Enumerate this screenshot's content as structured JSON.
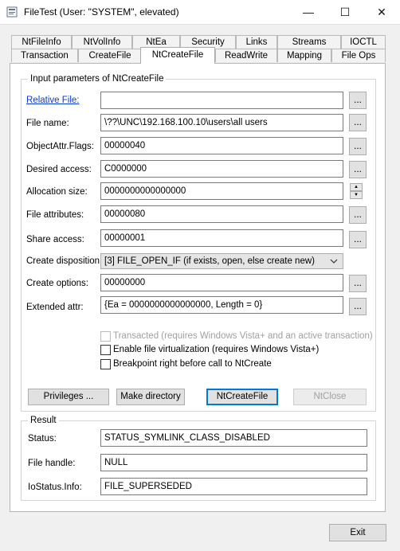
{
  "window": {
    "title": "FileTest (User: \"SYSTEM\", elevated)",
    "minimize": "—",
    "maximize": "☐",
    "close": "✕"
  },
  "tabs": {
    "row1": [
      "NtFileInfo",
      "NtVolInfo",
      "NtEa",
      "Security",
      "Links",
      "Streams",
      "IOCTL"
    ],
    "row2": [
      "Transaction",
      "CreateFile",
      "NtCreateFile",
      "ReadWrite",
      "Mapping",
      "File Ops"
    ],
    "active": "NtCreateFile"
  },
  "input_group": {
    "title": "Input parameters of NtCreateFile",
    "relative_file_label": "Relative File:",
    "relative_file_value": "",
    "file_name_label": "File name:",
    "file_name_value": "\\??\\UNC\\192.168.100.10\\users\\all users",
    "objattr_label": "ObjectAttr.Flags:",
    "objattr_value": "00000040",
    "desired_access_label": "Desired access:",
    "desired_access_value": "C0000000",
    "allocation_label": "Allocation size:",
    "allocation_value": "0000000000000000",
    "file_attr_label": "File attributes:",
    "file_attr_value": "00000080",
    "share_label": "Share access:",
    "share_value": "00000001",
    "disposition_label": "Create disposition:",
    "disposition_value": "[3] FILE_OPEN_IF (if exists, open, else create new)",
    "options_label": "Create options:",
    "options_value": "00000000",
    "ea_label": "Extended attr:",
    "ea_value": "{Ea = 0000000000000000, Length = 0}",
    "browse": "...",
    "checkboxes": [
      {
        "label": "Transacted (requires Windows Vista+ and an active transaction)",
        "checked": false,
        "enabled": false
      },
      {
        "label": "Enable file virtualization (requires Windows Vista+)",
        "checked": false,
        "enabled": true
      },
      {
        "label": "Breakpoint right before call to NtCreate",
        "checked": false,
        "enabled": true
      }
    ],
    "buttons": {
      "privileges": "Privileges ...",
      "make_directory": "Make directory",
      "ntcreatefile": "NtCreateFile",
      "ntclose": "NtClose"
    }
  },
  "result_group": {
    "title": "Result",
    "status_label": "Status:",
    "status_value": "STATUS_SYMLINK_CLASS_DISABLED",
    "handle_label": "File handle:",
    "handle_value": "NULL",
    "iostatus_label": "IoStatus.Info:",
    "iostatus_value": "FILE_SUPERSEDED"
  },
  "footer": {
    "exit": "Exit"
  },
  "colors": {
    "link": "#0b3ad6",
    "focus_border": "#0078d7",
    "disabled_text": "#a0a0a0"
  },
  "icons": {
    "app": "filetest-app-icon",
    "min": "minimize-icon",
    "max": "maximize-icon",
    "close": "close-icon"
  }
}
